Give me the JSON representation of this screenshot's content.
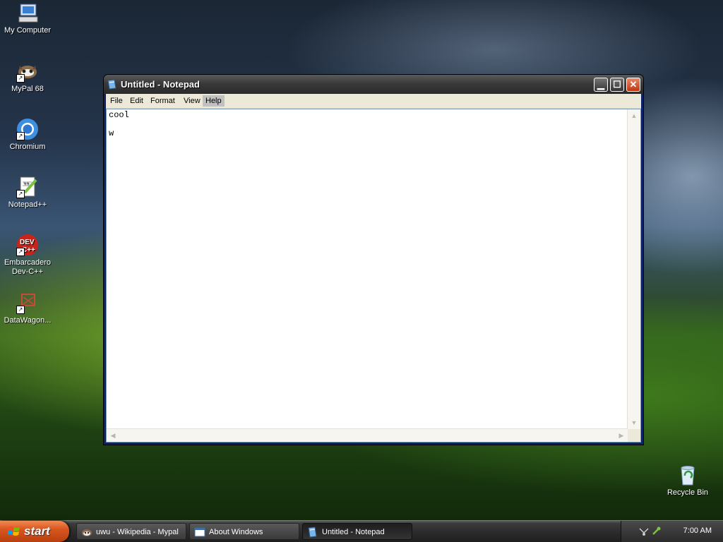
{
  "desktop": {
    "icons": [
      {
        "label": "My Computer",
        "icon": "my-computer-icon"
      },
      {
        "label": "MyPal 68",
        "icon": "mypal-icon"
      },
      {
        "label": "Chromium",
        "icon": "chromium-icon"
      },
      {
        "label": "Notepad++",
        "icon": "notepad-plus-plus-icon"
      },
      {
        "label": "Embarcadero Dev-C++",
        "icon": "devcpp-icon"
      },
      {
        "label": "DataWagon...",
        "icon": "datawagon-icon"
      },
      {
        "label": "Recycle Bin",
        "icon": "recycle-bin-icon"
      }
    ],
    "devcpp_badge_text": "DEV\nC++"
  },
  "notepad": {
    "title": "Untitled - Notepad",
    "menu": [
      "File",
      "Edit",
      "Format",
      "View",
      "Help"
    ],
    "active_menu": "Help",
    "content": "cool\n\nw",
    "controls": {
      "minimize": "▁",
      "maximize": "☐",
      "close": "✕"
    }
  },
  "taskbar": {
    "start_label": "start",
    "tasks": [
      {
        "label": "uwu - Wikipedia - Mypal",
        "icon": "mypal-icon",
        "active": false
      },
      {
        "label": "About Windows",
        "icon": "window-icon",
        "active": false
      },
      {
        "label": "Untitled - Notepad",
        "icon": "notepad-icon",
        "active": true
      }
    ],
    "clock": "7:00 AM"
  },
  "colors": {
    "start_orange": "#d9551f",
    "titlebar": "#3a3a3a",
    "close_red": "#c2350f"
  }
}
